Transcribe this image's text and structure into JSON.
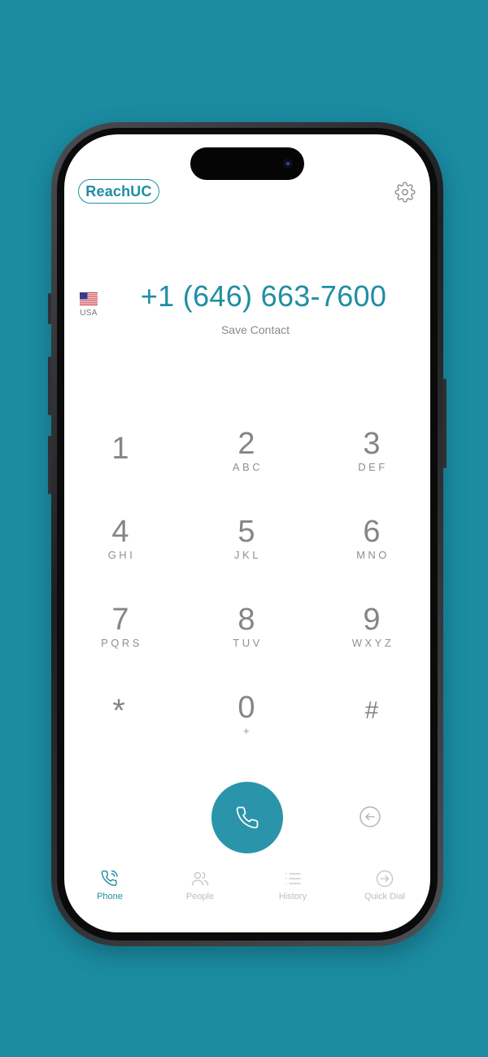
{
  "app": {
    "brand": "ReachUC"
  },
  "dialer": {
    "country_code": "USA",
    "number": "+1 (646) 663-7600",
    "save_contact_label": "Save Contact"
  },
  "keypad": [
    {
      "digit": "1",
      "letters": ""
    },
    {
      "digit": "2",
      "letters": "ABC"
    },
    {
      "digit": "3",
      "letters": "DEF"
    },
    {
      "digit": "4",
      "letters": "GHI"
    },
    {
      "digit": "5",
      "letters": "JKL"
    },
    {
      "digit": "6",
      "letters": "MNO"
    },
    {
      "digit": "7",
      "letters": "PQRS"
    },
    {
      "digit": "8",
      "letters": "TUV"
    },
    {
      "digit": "9",
      "letters": "WXYZ"
    },
    {
      "digit": "*",
      "letters": ""
    },
    {
      "digit": "0",
      "letters": "+"
    },
    {
      "digit": "#",
      "letters": ""
    }
  ],
  "tabs": [
    {
      "label": "Phone",
      "icon": "phone-icon",
      "active": true
    },
    {
      "label": "People",
      "icon": "people-icon",
      "active": false
    },
    {
      "label": "History",
      "icon": "history-icon",
      "active": false
    },
    {
      "label": "Quick Dial",
      "icon": "quick-dial-icon",
      "active": false
    }
  ],
  "icons": {
    "settings": "gear-icon",
    "call": "phone-icon",
    "backspace": "backspace-icon",
    "flag": "us-flag-icon"
  },
  "colors": {
    "background": "#1b8ca2",
    "accent": "#1f8ea3",
    "call_button": "#2a95aa",
    "key_text": "#858585",
    "inactive_tab": "#bdbdbd"
  }
}
